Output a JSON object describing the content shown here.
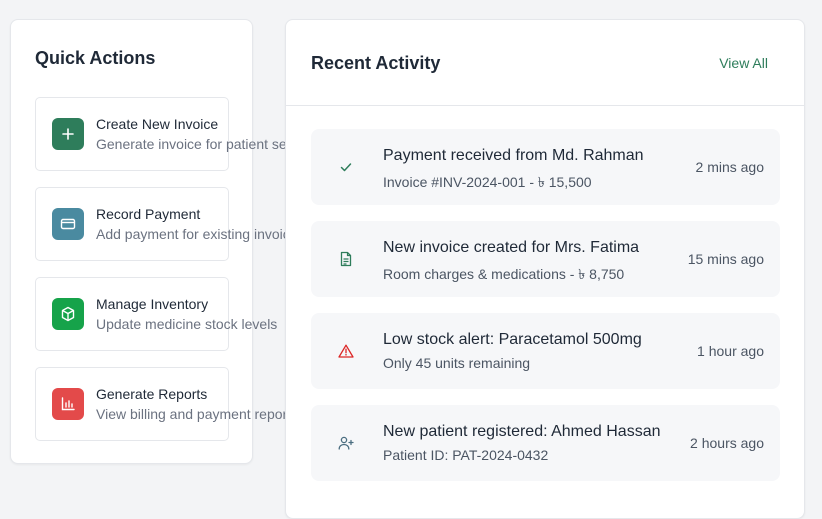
{
  "quick_actions": {
    "title": "Quick Actions",
    "items": [
      {
        "title": "Create New Invoice",
        "subtitle": "Generate invoice for patient se",
        "icon": "plus-icon",
        "color": "#2e7d5b"
      },
      {
        "title": "Record Payment",
        "subtitle": "Add payment for existing invoic",
        "icon": "credit-card-icon",
        "color": "#4a8aa0"
      },
      {
        "title": "Manage Inventory",
        "subtitle": "Update medicine stock levels",
        "icon": "box-icon",
        "color": "#16a34a"
      },
      {
        "title": "Generate Reports",
        "subtitle": "View billing and payment repor",
        "icon": "bar-chart-icon",
        "color": "#e34a4a"
      }
    ]
  },
  "recent_activity": {
    "title": "Recent Activity",
    "view_all_label": "View All",
    "items": [
      {
        "title": "Payment received from Md. Rahman",
        "subtitle": "Invoice #INV-2024-001 - ৳ 15,500",
        "time": "2 mins ago",
        "icon": "check-icon",
        "color": "#2e7d5b"
      },
      {
        "title": "New invoice created for Mrs. Fatima",
        "subtitle": "Room charges & medications - ৳ 8,750",
        "time": "15 mins ago",
        "icon": "document-icon",
        "color": "#2e7d5b"
      },
      {
        "title": "Low stock alert: Paracetamol 500mg",
        "subtitle": "Only 45 units remaining",
        "time": "1 hour ago",
        "icon": "warning-icon",
        "color": "#dc2626"
      },
      {
        "title": "New patient registered: Ahmed Hassan",
        "subtitle": "Patient ID: PAT-2024-0432",
        "time": "2 hours ago",
        "icon": "user-plus-icon",
        "color": "#4a6d80"
      }
    ]
  }
}
